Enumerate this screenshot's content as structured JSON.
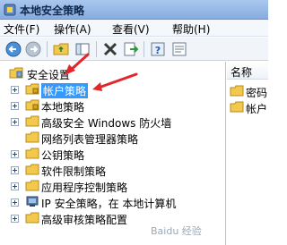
{
  "window": {
    "title": "本地安全策略"
  },
  "menu": {
    "items": [
      "文件(F)",
      "操作(A)",
      "查看(V)",
      "帮助(H)"
    ]
  },
  "toolbar": {
    "buttons": [
      "back-icon",
      "forward-icon",
      "up-folder-icon",
      "console-tree-icon",
      "delete-icon",
      "export-icon",
      "help-icon",
      "properties-icon"
    ]
  },
  "tree": {
    "root_label": "安全设置",
    "items": [
      {
        "label": "帐户策略",
        "selected": true
      },
      {
        "label": "本地策略",
        "selected": false
      },
      {
        "label": "高级安全 Windows 防火墙",
        "selected": false
      },
      {
        "label": "网络列表管理器策略",
        "selected": false
      },
      {
        "label": "公钥策略",
        "selected": false
      },
      {
        "label": "软件限制策略",
        "selected": false
      },
      {
        "label": "应用程序控制策略",
        "selected": false
      },
      {
        "label": "IP 安全策略，在 本地计算机",
        "selected": false
      },
      {
        "label": "高级审核策略配置",
        "selected": false
      }
    ]
  },
  "details": {
    "column_header": "名称",
    "items": [
      {
        "label": "密码"
      },
      {
        "label": "帐户"
      }
    ]
  },
  "watermark": "Baidu 经验"
}
